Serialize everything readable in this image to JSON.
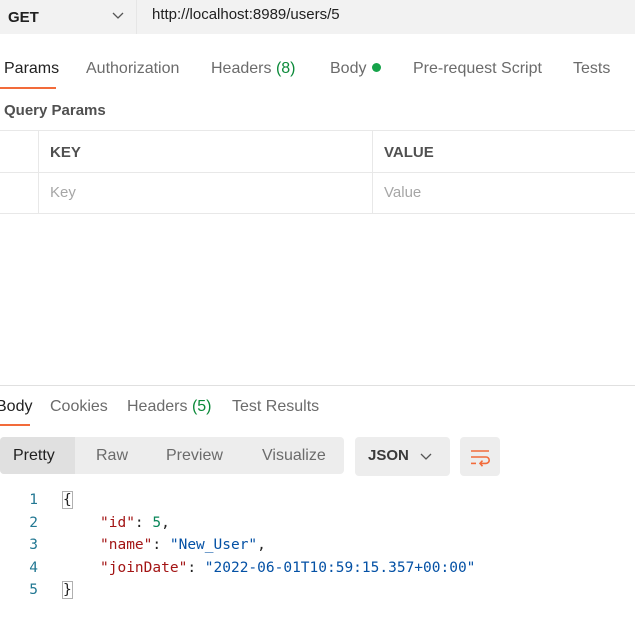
{
  "request": {
    "method": "GET",
    "url": "http://localhost:8989/users/5"
  },
  "request_tabs": {
    "params": "Params",
    "authorization": "Authorization",
    "headers": "Headers",
    "headers_count": "(8)",
    "body": "Body",
    "pre_request": "Pre-request Script",
    "tests": "Tests"
  },
  "query_params": {
    "title": "Query Params",
    "key_header": "KEY",
    "value_header": "VALUE",
    "key_placeholder": "Key",
    "value_placeholder": "Value"
  },
  "response_tabs": {
    "body": "Body",
    "cookies": "Cookies",
    "headers": "Headers",
    "headers_count": "(5)",
    "test_results": "Test Results"
  },
  "view_modes": {
    "pretty": "Pretty",
    "raw": "Raw",
    "preview": "Preview",
    "visualize": "Visualize"
  },
  "format": "JSON",
  "code": {
    "line_numbers": [
      "1",
      "2",
      "3",
      "4",
      "5"
    ],
    "open_brace": "{",
    "close_brace": "}",
    "id_key": "\"id\"",
    "id_value": "5",
    "name_key": "\"name\"",
    "name_value": "\"New_User\"",
    "joindate_key": "\"joinDate\"",
    "joindate_value": "\"2022-06-01T10:59:15.357+00:00\""
  },
  "colors": {
    "accent": "#f26b3a",
    "count_green": "#0c8a3a",
    "json_key": "#a31515",
    "json_number": "#098658",
    "json_string": "#0451a5"
  }
}
